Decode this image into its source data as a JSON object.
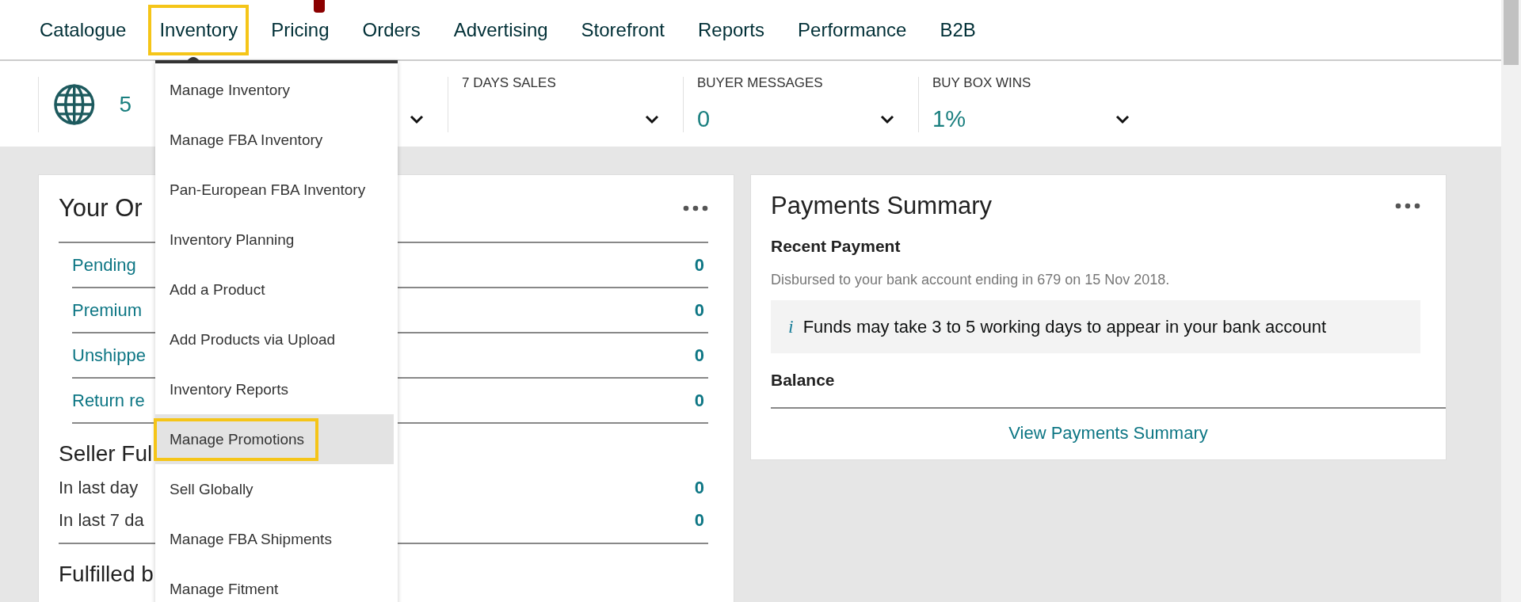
{
  "nav": {
    "items": [
      {
        "label": "Catalogue",
        "selected": false
      },
      {
        "label": "Inventory",
        "selected": true
      },
      {
        "label": "Pricing",
        "selected": false
      },
      {
        "label": "Orders",
        "selected": false
      },
      {
        "label": "Advertising",
        "selected": false
      },
      {
        "label": "Storefront",
        "selected": false
      },
      {
        "label": "Reports",
        "selected": false
      },
      {
        "label": "Performance",
        "selected": false
      },
      {
        "label": "B2B",
        "selected": false
      }
    ]
  },
  "marketplaces": {
    "count": "5"
  },
  "metrics": [
    {
      "label": "7 DAYS SALES"
    },
    {
      "label": "BUYER MESSAGES",
      "value": "0"
    },
    {
      "label": "BUY BOX WINS",
      "value": "1%"
    }
  ],
  "inventory_menu": {
    "items": [
      {
        "label": "Manage Inventory",
        "selected": false
      },
      {
        "label": "Manage FBA Inventory",
        "selected": false
      },
      {
        "label": "Pan-European FBA Inventory",
        "selected": false
      },
      {
        "label": "Inventory Planning",
        "selected": false
      },
      {
        "label": "Add a Product",
        "selected": false
      },
      {
        "label": "Add Products via Upload",
        "selected": false
      },
      {
        "label": "Inventory Reports",
        "selected": false
      },
      {
        "label": "Manage Promotions",
        "selected": true
      },
      {
        "label": "Sell Globally",
        "selected": false
      },
      {
        "label": "Manage FBA Shipments",
        "selected": false
      },
      {
        "label": "Manage Fitment",
        "selected": false
      }
    ]
  },
  "orders_card": {
    "title": "Your Or",
    "rows": [
      {
        "label": "Pending",
        "value": "0"
      },
      {
        "label": "Premium",
        "value": "0"
      },
      {
        "label": "Unshippe",
        "value": "0"
      },
      {
        "label": "Return re",
        "value": "0"
      }
    ],
    "seller_section": {
      "title": "Seller Ful",
      "rows": [
        {
          "label": "In last day",
          "value": "0"
        },
        {
          "label": "In last 7 da",
          "value": "0"
        }
      ]
    },
    "next_section": {
      "title": "Fulfilled b"
    }
  },
  "payments_card": {
    "title": "Payments Summary",
    "recent_heading": "Recent Payment",
    "recent_text": "Disbursed to your bank account ending in 679 on 15 Nov 2018.",
    "info_icon": "i",
    "info_text": "Funds may take 3 to 5 working days to appear in your bank account",
    "balance_heading": "Balance",
    "link": "View Payments Summary"
  }
}
